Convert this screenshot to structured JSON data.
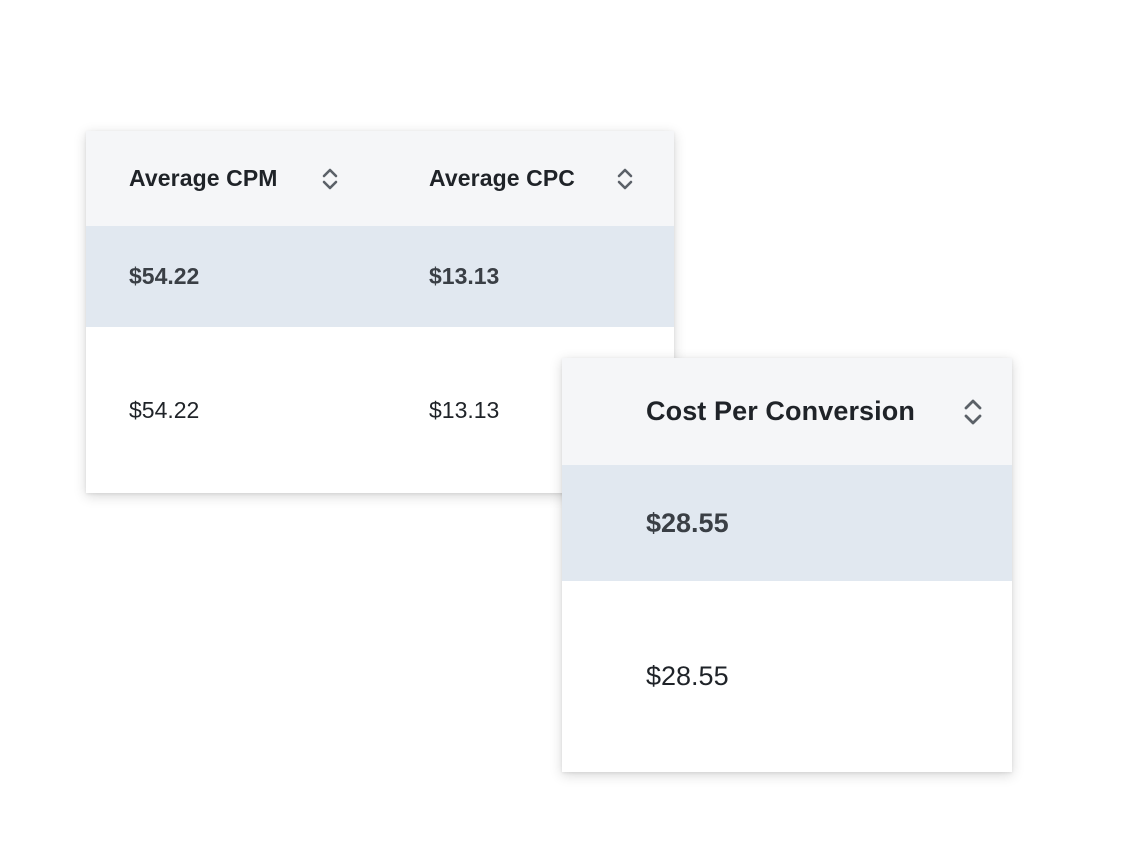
{
  "colors": {
    "header_bg": "#f5f6f8",
    "highlight_bg": "#e1e8f0",
    "text": "#1f2328",
    "muted_text": "#3a3f45",
    "icon": "#5b6168"
  },
  "table_left": {
    "columns": [
      {
        "label": "Average CPM",
        "sort_icon": "sort-icon"
      },
      {
        "label": "Average CPC",
        "sort_icon": "sort-icon"
      }
    ],
    "rows": [
      {
        "cells": [
          "$54.22",
          "$13.13"
        ]
      },
      {
        "cells": [
          "$54.22",
          "$13.13"
        ]
      }
    ]
  },
  "table_right": {
    "columns": [
      {
        "label": "Cost Per Conversion",
        "sort_icon": "sort-icon"
      }
    ],
    "rows": [
      {
        "cells": [
          "$28.55"
        ]
      },
      {
        "cells": [
          "$28.55"
        ]
      }
    ]
  }
}
